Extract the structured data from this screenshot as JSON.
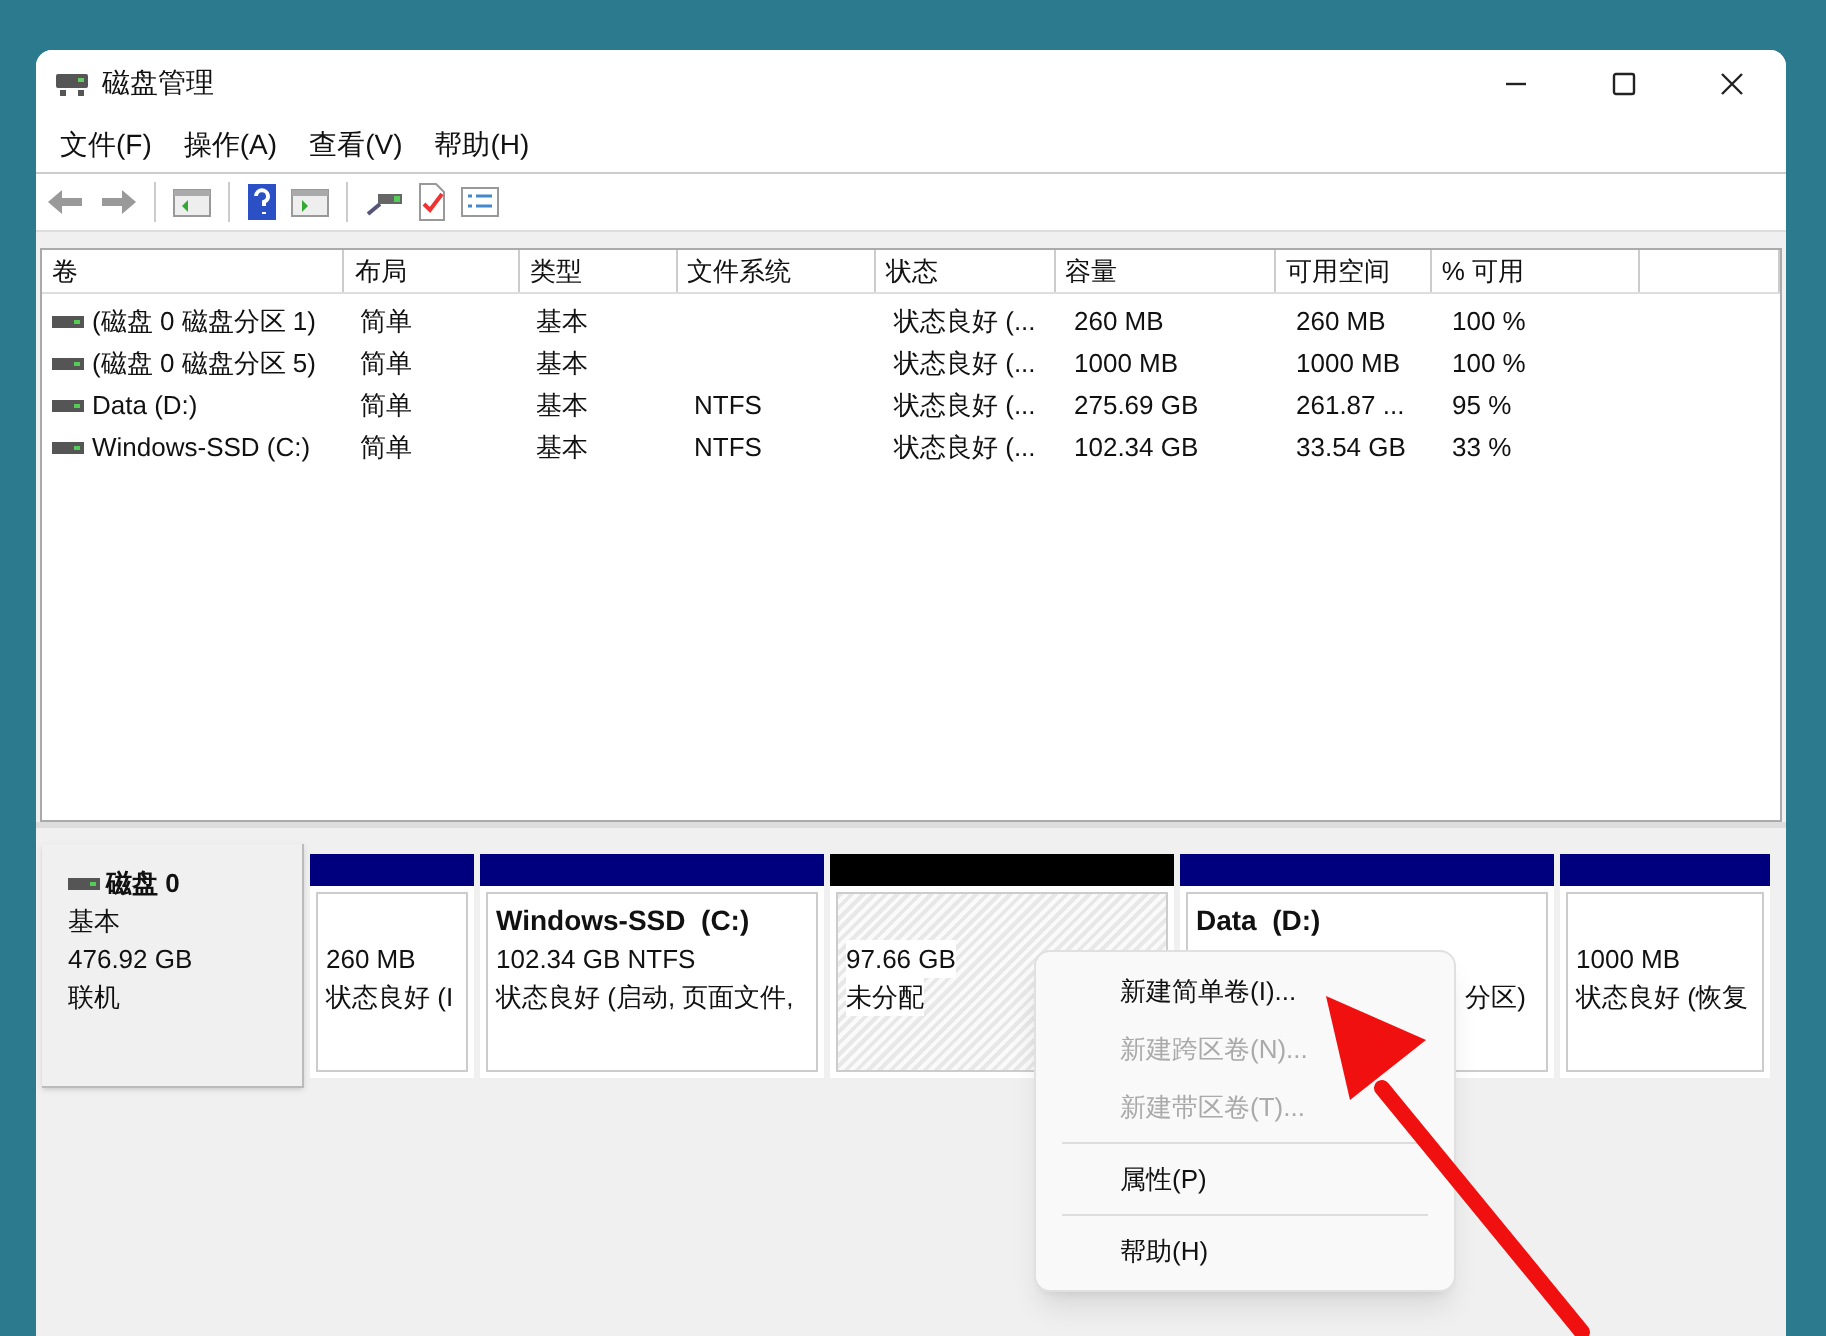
{
  "window": {
    "title": "磁盘管理"
  },
  "menu": [
    "文件(F)",
    "操作(A)",
    "查看(V)",
    "帮助(H)"
  ],
  "table": {
    "columns": [
      "卷",
      "布局",
      "类型",
      "文件系统",
      "状态",
      "容量",
      "可用空间",
      "% 可用"
    ],
    "rows": [
      [
        "(磁盘 0 磁盘分区 1)",
        "简单",
        "基本",
        "",
        "状态良好 (...",
        "260 MB",
        "260 MB",
        "100 %"
      ],
      [
        "(磁盘 0 磁盘分区 5)",
        "简单",
        "基本",
        "",
        "状态良好 (...",
        "1000 MB",
        "1000 MB",
        "100 %"
      ],
      [
        "Data (D:)",
        "简单",
        "基本",
        "NTFS",
        "状态良好 (...",
        "275.69 GB",
        "261.87 ...",
        "95 %"
      ],
      [
        "Windows-SSD (C:)",
        "简单",
        "基本",
        "NTFS",
        "状态良好 (...",
        "102.34 GB",
        "33.54 GB",
        "33 %"
      ]
    ]
  },
  "disk": {
    "name": "磁盘 0",
    "type": "基本",
    "size": "476.92 GB",
    "status": "联机"
  },
  "partitions": [
    {
      "kind": "allocated",
      "lines": [
        "260 MB",
        "状态良好 (I"
      ]
    },
    {
      "kind": "allocated",
      "title": "Windows-SSD  (C:)",
      "lines": [
        "102.34 GB NTFS",
        "状态良好 (启动, 页面文件,"
      ]
    },
    {
      "kind": "unallocated",
      "lines": [
        "97.66 GB",
        "未分配"
      ]
    },
    {
      "kind": "allocated",
      "title": "Data  (D:)",
      "tail": "分区)"
    },
    {
      "kind": "allocated",
      "lines": [
        "1000 MB",
        "状态良好 (恢复"
      ]
    }
  ],
  "context_menu": [
    {
      "kind": "item",
      "label": "新建简单卷(I)...",
      "disabled": false
    },
    {
      "kind": "item",
      "label": "新建跨区卷(N)...",
      "disabled": true
    },
    {
      "kind": "item",
      "label": "新建带区卷(T)...",
      "disabled": true
    },
    {
      "kind": "separator"
    },
    {
      "kind": "item",
      "label": "属性(P)",
      "disabled": false
    },
    {
      "kind": "separator"
    },
    {
      "kind": "item",
      "label": "帮助(H)",
      "disabled": false
    }
  ]
}
